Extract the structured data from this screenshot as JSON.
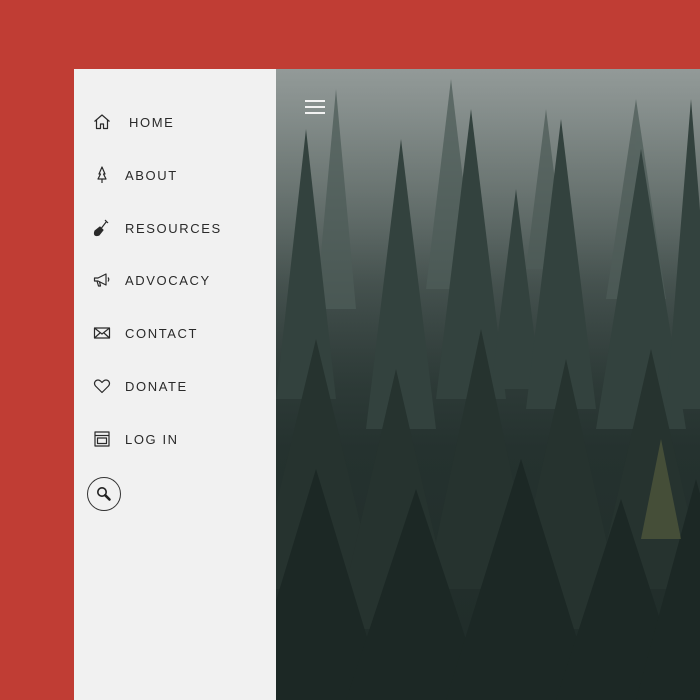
{
  "colors": {
    "page_background": "#c03d34",
    "sidebar_background": "#f1f1f1",
    "nav_text": "#2a2a2a"
  },
  "nav": {
    "items": [
      {
        "label": "HOME",
        "icon": "home-icon"
      },
      {
        "label": "ABOUT",
        "icon": "tree-icon"
      },
      {
        "label": "RESOURCES",
        "icon": "shovel-icon"
      },
      {
        "label": "ADVOCACY",
        "icon": "megaphone-icon"
      },
      {
        "label": "CONTACT",
        "icon": "envelope-icon"
      },
      {
        "label": "DONATE",
        "icon": "heart-icon"
      },
      {
        "label": "LOG IN",
        "icon": "browser-window-icon"
      }
    ],
    "search_icon": "search-icon"
  },
  "hero": {
    "menu_icon": "hamburger-menu-icon",
    "image": "misty-pine-forest-photo"
  }
}
